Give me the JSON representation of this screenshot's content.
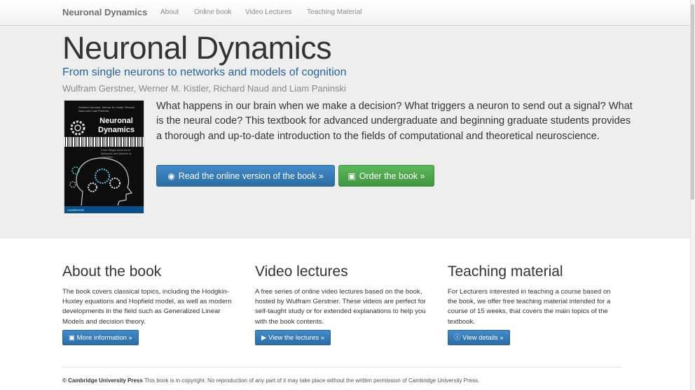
{
  "nav": {
    "brand": "Neuronal Dynamics",
    "links": [
      "About",
      "Online book",
      "Video Lectures",
      "Teaching Material"
    ]
  },
  "hero": {
    "title": "Neuronal Dynamics",
    "subtitle": "From single neurons to networks and models of cognition",
    "authors": "Wulfram Gerstner, Werner M. Kistler, Richard Naud and Liam Paninski",
    "description": "What happens in our brain when we make a decision? What triggers a neuron to send out a signal? What is the neural code? This textbook for advanced undergraduate and beginning graduate students provides a thorough and up-to-date introduction to the fields of computational and theoretical neuroscience.",
    "read_button": "Read the online version of the book »",
    "order_button": "Order the book »",
    "cover": {
      "top_text": "Wulfram Gerstner, Werner M. Kistler, Richard Naud and Liam Paninski",
      "title": "Neuronal Dynamics",
      "subtitle": "From Single Neurons to Networks and Models of Cognition",
      "publisher": "CAMBRIDGE"
    }
  },
  "columns": [
    {
      "heading": "About the book",
      "text": "The book covers classical topics, including the Hodgkin-Huxley equations and Hopfield model, as well as modern developments in the field such as Generalized Linear Models and decision theory.",
      "button": "More information »"
    },
    {
      "heading": "Video lectures",
      "text": "A free series of online video lectures based on the book, hosted by Wulfram Gerstner. These videos are perfect for self-taught study or for extended explanations to help you with the book contents.",
      "button": "View the lectures »"
    },
    {
      "heading": "Teaching material",
      "text": "For Lecturers interested in teaching a course based on the book, we offer free teaching material intended for a course of 15 weeks, that covers the main topics of the textbook.",
      "button": "View details »"
    }
  ],
  "footer": {
    "publisher": "© Cambridge University Press",
    "notice": "This book is in copyright. No reproduction of any part of it may take place without the written permission of Cambridge University Press."
  },
  "colors": {
    "primary": "#428bca",
    "success": "#5cb85c",
    "subtitle": "#2a6496",
    "hero_bg": "#eeeeee"
  }
}
